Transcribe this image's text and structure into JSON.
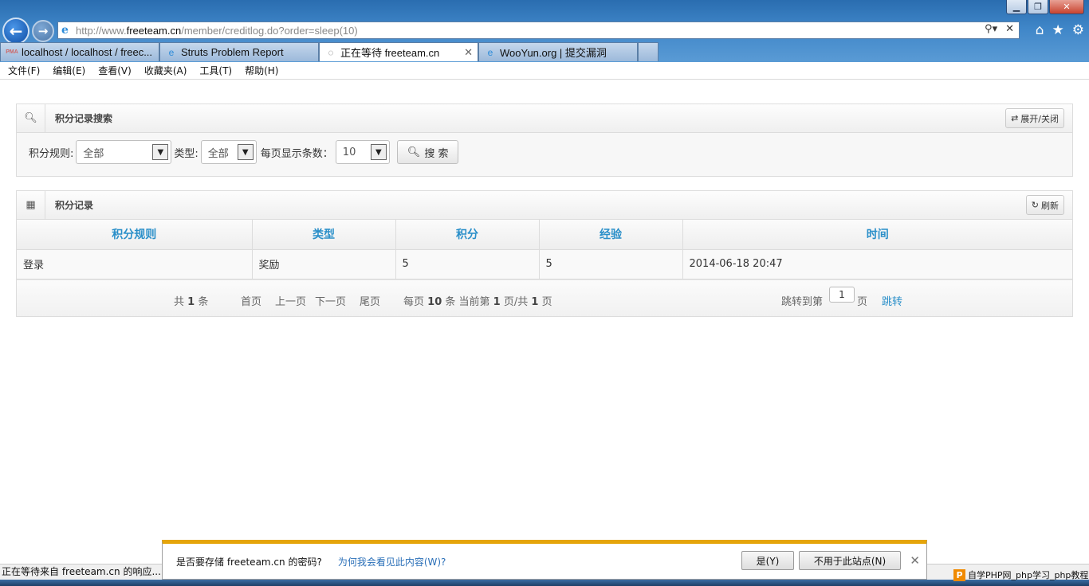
{
  "browser": {
    "url_domain_prefix": "http://www.",
    "url_domain": "freeteam.cn",
    "url_path": "/member/creditlog.do?order=sleep(10)",
    "tabs": [
      {
        "label": "localhost / localhost / freec...",
        "icon": "pma-icon"
      },
      {
        "label": "Struts Problem Report",
        "icon": "ie-icon"
      },
      {
        "label": "正在等待 freeteam.cn",
        "icon": "loading-icon",
        "active": true
      },
      {
        "label": "WooYun.org | 提交漏洞",
        "icon": "ie-icon"
      }
    ],
    "menu": [
      "文件(F)",
      "编辑(E)",
      "查看(V)",
      "收藏夹(A)",
      "工具(T)",
      "帮助(H)"
    ],
    "status": "正在等待来自 freeteam.cn 的响应..."
  },
  "search_panel": {
    "title": "积分记录搜索",
    "toggle_label": "展开/关闭",
    "rule_label": "积分规则:",
    "rule_value": "全部",
    "type_label": "类型:",
    "type_value": "全部",
    "per_page_label": "每页显示条数：",
    "per_page_value": "10",
    "search_button": "搜 索"
  },
  "records_panel": {
    "title": "积分记录",
    "refresh_label": "刷新",
    "columns": [
      "积分规则",
      "类型",
      "积分",
      "经验",
      "时间"
    ],
    "rows": [
      [
        "登录",
        "奖励",
        "5",
        "5",
        "2014-06-18 20:47"
      ]
    ]
  },
  "pager": {
    "total_prefix": "共",
    "total": "1",
    "total_suffix": "条",
    "first": "首页",
    "prev": "上一页",
    "next": "下一页",
    "last": "尾页",
    "per_page_prefix": "每页",
    "per_page": "10",
    "per_page_mid": "条 当前第",
    "current": "1",
    "of": "页/共",
    "pages": "1",
    "page_suffix": "页",
    "jump_label": "跳转到第",
    "jump_value": "1",
    "jump_suffix": "页",
    "jump_button": "跳转"
  },
  "notification": {
    "message": "是否要存储 freeteam.cn 的密码?",
    "why_link": "为何我会看见此内容(W)?",
    "yes": "是(Y)",
    "never": "不用于此站点(N)"
  },
  "ad_text": "自学PHP网_php学习_php教程"
}
